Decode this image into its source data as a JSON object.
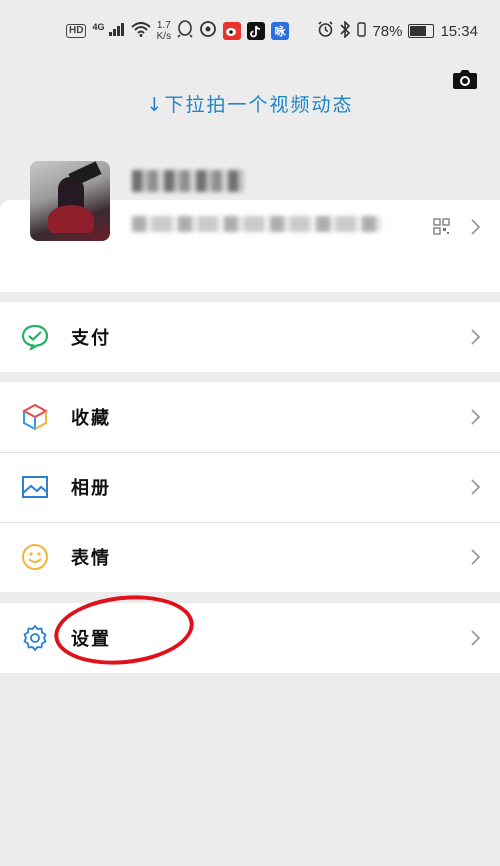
{
  "status_bar": {
    "hd": "HD",
    "network": "4G",
    "speed_value": "1.7",
    "speed_unit": "K/s",
    "app_icons": [
      "qq-icon",
      "netease-icon",
      "weibo-icon",
      "tiktok-icon",
      "baidu-icon"
    ],
    "baidu_label": "咏",
    "battery": "78%",
    "battery_level": 0.78,
    "time": "15:34"
  },
  "pull_hint": "↓下拉拍一个视频动态",
  "menu": {
    "pay": "支付",
    "favorites": "收藏",
    "album": "相册",
    "stickers": "表情",
    "settings": "设置"
  },
  "colors": {
    "hint": "#1e86c7",
    "pay_green": "#20b463",
    "icon_blue": "#2c7fd1",
    "sticker_yellow": "#f3b43a",
    "annotation_red": "#e0101c",
    "background": "#ececec"
  }
}
